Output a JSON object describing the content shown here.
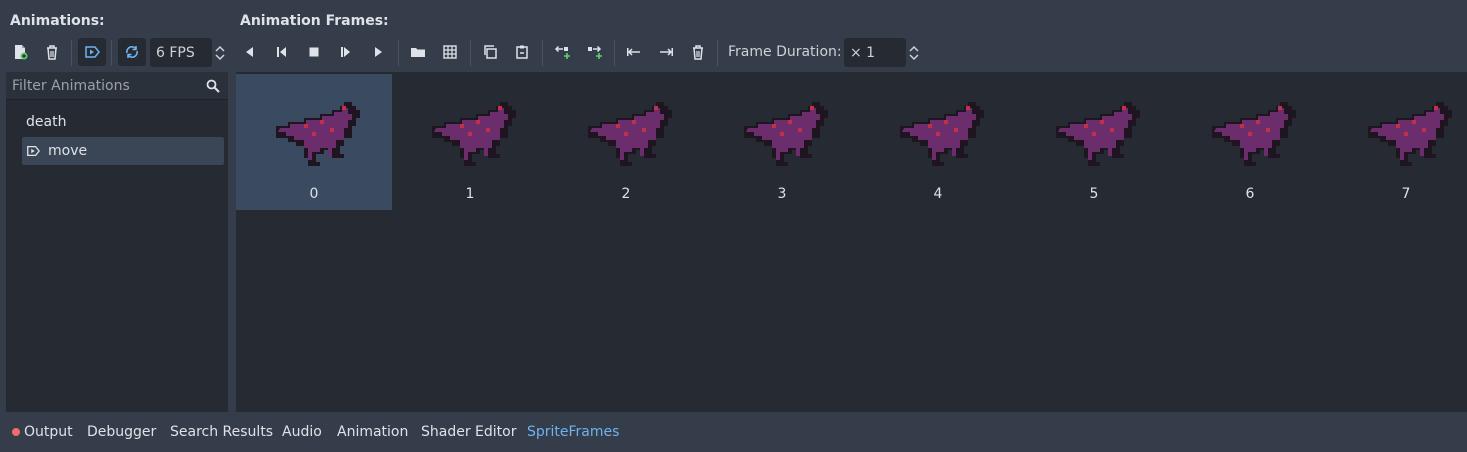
{
  "panels": {
    "animations_heading": "Animations:",
    "frames_heading": "Animation Frames:"
  },
  "toolbar": {
    "fps_value": "6 FPS",
    "frame_duration_label": "Frame Duration:",
    "frame_duration_value": "× 1"
  },
  "filter": {
    "placeholder": "Filter Animations"
  },
  "animations": [
    {
      "label": "death",
      "selected": false
    },
    {
      "label": "move",
      "selected": true
    }
  ],
  "frames": [
    {
      "index": "0",
      "selected": true
    },
    {
      "index": "1"
    },
    {
      "index": "2"
    },
    {
      "index": "3"
    },
    {
      "index": "4"
    },
    {
      "index": "5"
    },
    {
      "index": "6"
    },
    {
      "index": "7"
    }
  ],
  "bottom_tabs": [
    {
      "label": "Output"
    },
    {
      "label": "Debugger"
    },
    {
      "label": "Search Results"
    },
    {
      "label": "Audio"
    },
    {
      "label": "Animation"
    },
    {
      "label": "Shader Editor"
    },
    {
      "label": "SpriteFrames",
      "active": true
    }
  ],
  "colors": {
    "accent": "#6fb2f0",
    "output_dot": "#f26b6b",
    "sprite_body": "#6b2d6b",
    "sprite_outline": "#1e1520",
    "sprite_spots": "#c0304a"
  }
}
